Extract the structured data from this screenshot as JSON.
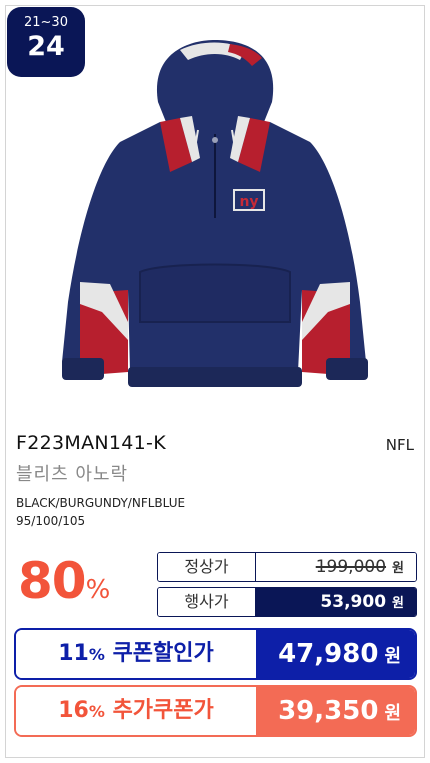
{
  "rank": {
    "range": "21~30",
    "number": "24"
  },
  "product": {
    "code": "F223MAN141-K",
    "brand": "NFL",
    "name": "블리츠 아노락",
    "colors": "BLACK/BURGUNDY/NFLBLUE",
    "sizes": "95/100/105",
    "logo_text": "ny"
  },
  "discount": {
    "percent": "80",
    "sign": "%"
  },
  "prices": {
    "normal_label": "정상가",
    "normal_value": "199,000",
    "sale_label": "행사가",
    "sale_value": "53,900",
    "currency": "원"
  },
  "coupon": {
    "percent": "11",
    "pct_sign": "%",
    "label": "쿠폰할인가",
    "value": "47,980",
    "currency": "원"
  },
  "extra": {
    "percent": "16",
    "pct_sign": "%",
    "label": "추가쿠폰가",
    "value": "39,350",
    "currency": "원"
  },
  "colors": {
    "navy": "#0a1656",
    "coupon_blue": "#0d1fa8",
    "coral": "#f36b55",
    "discount_red": "#f2543a",
    "jacket_navy": "#22306a",
    "jacket_red": "#b71f2e",
    "jacket_white": "#e6e6e6"
  }
}
